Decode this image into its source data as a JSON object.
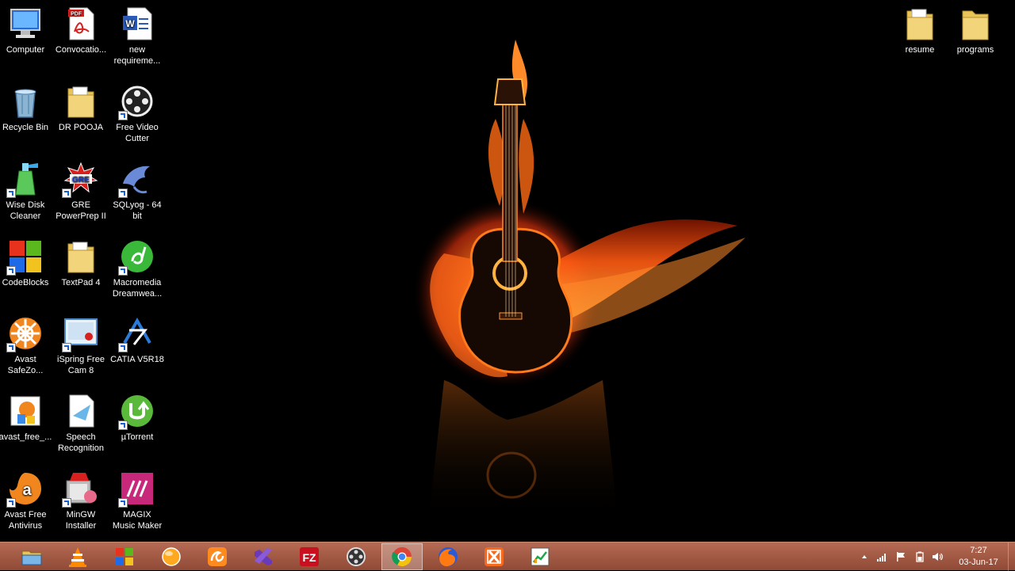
{
  "desktop": {
    "icons_left": [
      {
        "name": "computer",
        "label": "Computer"
      },
      {
        "name": "convocation-pdf",
        "label": "Convocatio..."
      },
      {
        "name": "new-requirements-doc",
        "label": "new\nrequireme..."
      },
      {
        "name": "recycle-bin",
        "label": "Recycle Bin"
      },
      {
        "name": "dr-pooja-folder",
        "label": "DR POOJA"
      },
      {
        "name": "free-video-cutter",
        "label": "Free Video\nCutter"
      },
      {
        "name": "wise-disk-cleaner",
        "label": "Wise Disk\nCleaner"
      },
      {
        "name": "gre-powerprep",
        "label": "GRE\nPowerPrep II"
      },
      {
        "name": "sqlyog",
        "label": "SQLyog - 64\nbit"
      },
      {
        "name": "codeblocks",
        "label": "CodeBlocks"
      },
      {
        "name": "textpad-4",
        "label": "TextPad 4"
      },
      {
        "name": "macromedia-dreamweaver",
        "label": "Macromedia\nDreamwea..."
      },
      {
        "name": "avast-safezone",
        "label": "Avast\nSafeZo..."
      },
      {
        "name": "ispring-free-cam",
        "label": "iSpring Free\nCam 8"
      },
      {
        "name": "catia-v5r18",
        "label": "CATIA V5R18"
      },
      {
        "name": "avast-free-installer",
        "label": "avast_free_..."
      },
      {
        "name": "speech-recognition",
        "label": "Speech\nRecognition"
      },
      {
        "name": "utorrent",
        "label": "µTorrent"
      },
      {
        "name": "avast-free-antivirus",
        "label": "Avast Free\nAntivirus"
      },
      {
        "name": "mingw-installer",
        "label": "MinGW\nInstaller"
      },
      {
        "name": "magix-music-maker",
        "label": "MAGIX\nMusic Maker"
      }
    ],
    "icons_right": [
      {
        "name": "resume-folder",
        "label": "resume"
      },
      {
        "name": "programs-folder",
        "label": "programs"
      }
    ],
    "pdf_badge": "PDF",
    "gre_badge": "GRE"
  },
  "taskbar": {
    "buttons": [
      "file-explorer",
      "vlc",
      "windows-store",
      "orb-app",
      "uc-browser",
      "visual-studio",
      "filezilla",
      "video-cutter",
      "chrome",
      "firefox",
      "xampp",
      "chart-app"
    ],
    "active": "chrome",
    "filezilla_label": "FZ"
  },
  "tray": {
    "time": "7:27",
    "date": "03-Jun-17"
  },
  "colors": {
    "taskbar": "#a35b45",
    "folder": "#e8c45a",
    "flame": "#ff7a1a"
  }
}
